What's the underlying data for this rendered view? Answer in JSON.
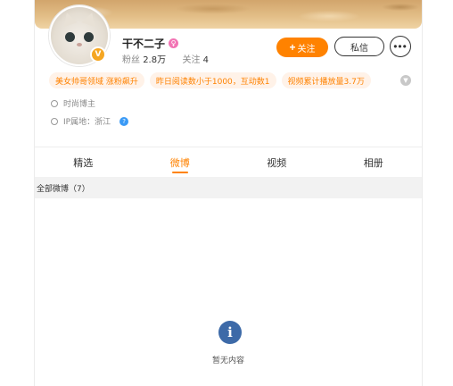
{
  "profile": {
    "name": "干不二子",
    "gender_icon": "female-icon",
    "verified_badge": "V",
    "stats": {
      "fans_label": "粉丝",
      "fans_value": "2.8万",
      "following_label": "关注",
      "following_value": "4"
    }
  },
  "actions": {
    "follow_plus": "+",
    "follow_label": "关注",
    "message_label": "私信",
    "more_icon": "more-icon"
  },
  "tags": [
    "美女帅哥领域 涨粉飙升",
    "昨日阅读数小于1000，互动数1",
    "视频累计播放量3.7万"
  ],
  "info": {
    "category": "时尚博主",
    "ip_location": "IP属地：浙江"
  },
  "tabs": [
    {
      "label": "精选",
      "active": false
    },
    {
      "label": "微博",
      "active": true
    },
    {
      "label": "视频",
      "active": false
    },
    {
      "label": "相册",
      "active": false
    }
  ],
  "section": {
    "title": "全部微博（7）"
  },
  "empty_state": {
    "icon": "info-icon",
    "text": "暂无内容"
  },
  "colors": {
    "accent": "#ff8200",
    "tag_bg": "#fff2e8",
    "empty_icon": "#3d6aa8",
    "help_icon": "#3a9af6"
  }
}
